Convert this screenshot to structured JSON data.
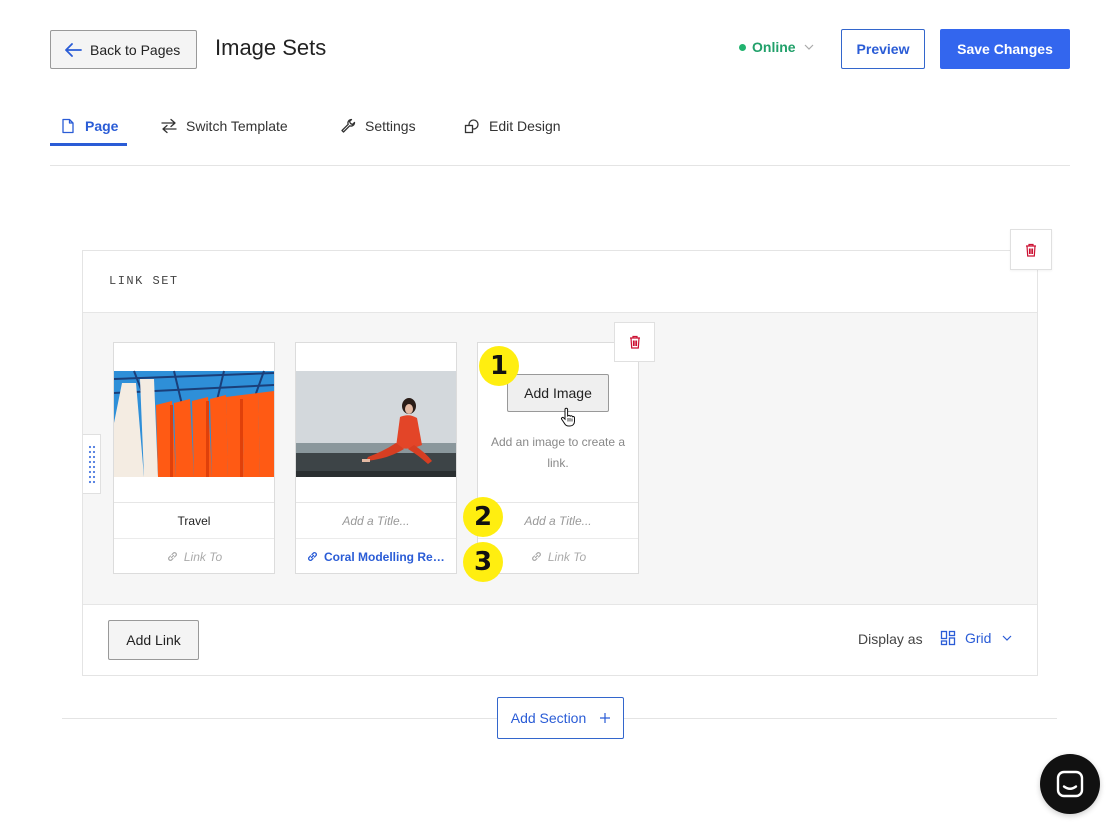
{
  "header": {
    "back_label": "Back to Pages",
    "page_title": "Image Sets",
    "status_label": "Online",
    "preview_label": "Preview",
    "save_label": "Save Changes"
  },
  "tabs": [
    {
      "label": "Page",
      "icon": "page-icon",
      "active": true
    },
    {
      "label": "Switch Template",
      "icon": "switch-arrows-icon",
      "active": false
    },
    {
      "label": "Settings",
      "icon": "wrench-icon",
      "active": false
    },
    {
      "label": "Edit Design",
      "icon": "design-icon",
      "active": false
    }
  ],
  "section": {
    "title": "LINK SET",
    "cards": [
      {
        "title": "Travel",
        "link": "Link To",
        "image": "orange-fabric-photo"
      },
      {
        "title": "Add a Title...",
        "link": "Coral Modelling Red...",
        "image": "woman-red-dress-photo"
      },
      {
        "title": "Add a Title...",
        "link": "Link To",
        "add_image_label": "Add Image",
        "hint": "Add an image to create a link."
      }
    ],
    "add_link_label": "Add Link",
    "display_as_label": "Display as",
    "display_value": "Grid"
  },
  "add_section_label": "Add Section",
  "annotations": [
    "1",
    "2",
    "3"
  ],
  "colors": {
    "accent": "#3366ee",
    "status_green": "#21a06a",
    "delete_red": "#cc1133",
    "badge_yellow": "#ffee10"
  }
}
